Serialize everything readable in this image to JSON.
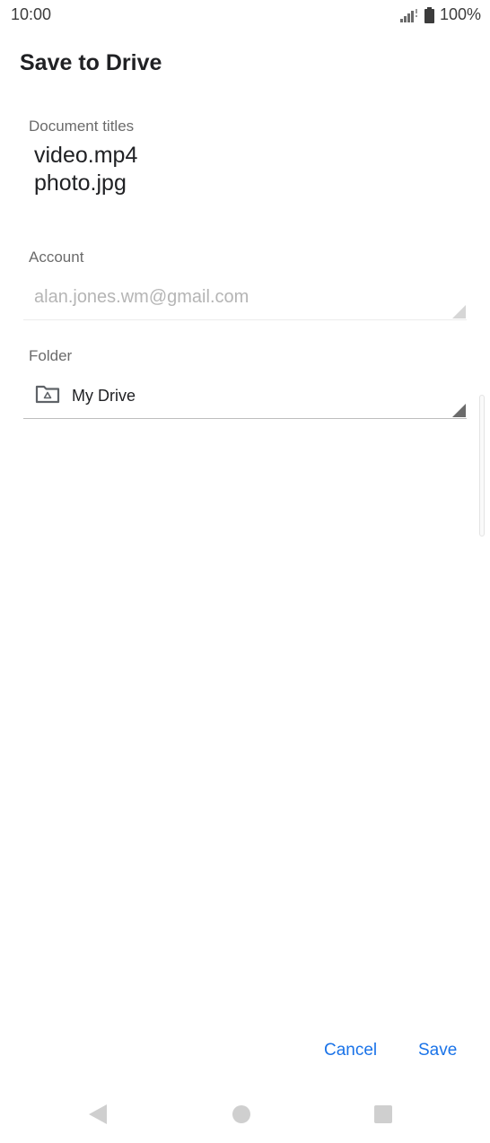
{
  "status_bar": {
    "time": "10:00",
    "battery_percent": "100%"
  },
  "dialog": {
    "title": "Save to Drive",
    "document_titles_label": "Document titles",
    "document_titles": [
      "video.mp4",
      "photo.jpg"
    ],
    "account_label": "Account",
    "account_value": "alan.jones.wm@gmail.com",
    "folder_label": "Folder",
    "folder_value": "My Drive",
    "cancel_label": "Cancel",
    "save_label": "Save"
  },
  "icons": {
    "signal": "signal-icon",
    "battery": "battery-icon",
    "folder": "drive-folder-icon",
    "dropdown": "dropdown-triangle-icon",
    "nav_back": "back-triangle-icon",
    "nav_home": "home-circle-icon",
    "nav_recents": "recents-square-icon"
  },
  "colors": {
    "accent": "#1a73e8",
    "nav_icon": "#cfcfcf",
    "disabled_text": "#b5b5b5"
  }
}
